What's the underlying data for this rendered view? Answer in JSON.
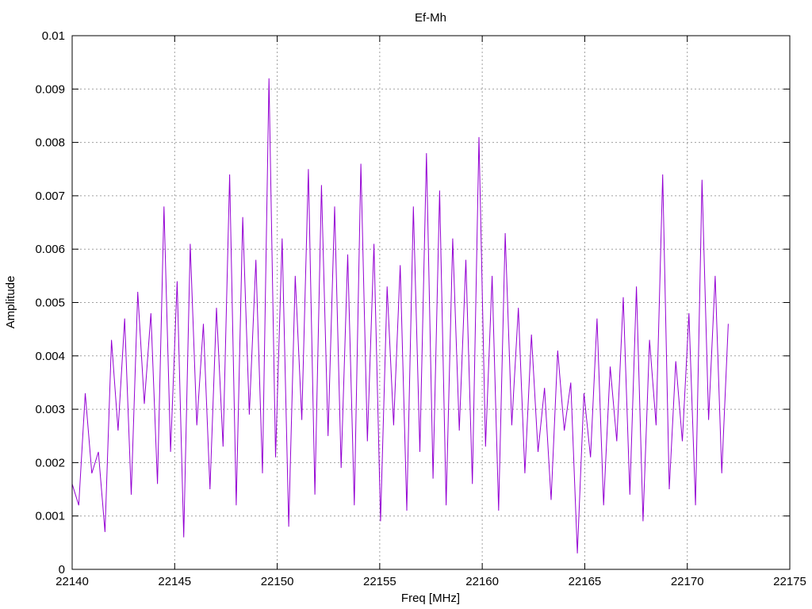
{
  "chart_data": {
    "type": "line",
    "title": "Ef-Mh",
    "xlabel": "Freq [MHz]",
    "ylabel": "Amplitude",
    "xlim": [
      22140,
      22175
    ],
    "ylim": [
      0,
      0.01
    ],
    "x_ticks": [
      "22140",
      "22145",
      "22150",
      "22155",
      "22160",
      "22165",
      "22170",
      "22175"
    ],
    "y_ticks": [
      "0",
      "0.001",
      "0.002",
      "0.003",
      "0.004",
      "0.005",
      "0.006",
      "0.007",
      "0.008",
      "0.009",
      "0.01"
    ],
    "grid": true,
    "legend": "none",
    "series": [
      {
        "color": "#9400d3",
        "x": [
          22140.0,
          22140.32,
          22140.64,
          22140.96,
          22141.28,
          22141.6,
          22141.92,
          22142.24,
          22142.56,
          22142.88,
          22143.2,
          22143.52,
          22143.84,
          22144.16,
          22144.48,
          22144.8,
          22145.12,
          22145.44,
          22145.76,
          22146.08,
          22146.4,
          22146.72,
          22147.04,
          22147.36,
          22147.68,
          22148.0,
          22148.32,
          22148.64,
          22148.96,
          22149.28,
          22149.6,
          22149.92,
          22150.24,
          22150.56,
          22150.88,
          22151.2,
          22151.52,
          22151.84,
          22152.16,
          22152.48,
          22152.8,
          22153.12,
          22153.44,
          22153.76,
          22154.08,
          22154.4,
          22154.72,
          22155.04,
          22155.36,
          22155.68,
          22156.0,
          22156.32,
          22156.64,
          22156.96,
          22157.28,
          22157.6,
          22157.92,
          22158.24,
          22158.56,
          22158.88,
          22159.2,
          22159.52,
          22159.84,
          22160.16,
          22160.48,
          22160.8,
          22161.12,
          22161.44,
          22161.76,
          22162.08,
          22162.4,
          22162.72,
          22163.04,
          22163.36,
          22163.68,
          22164.0,
          22164.32,
          22164.64,
          22164.96,
          22165.28,
          22165.6,
          22165.92,
          22166.24,
          22166.56,
          22166.88,
          22167.2,
          22167.52,
          22167.84,
          22168.16,
          22168.48,
          22168.8,
          22169.12,
          22169.44,
          22169.76,
          22170.08,
          22170.4,
          22170.72,
          22171.04,
          22171.36,
          22171.68,
          22172.0
        ],
        "y": [
          0.0016,
          0.0012,
          0.0033,
          0.0018,
          0.0022,
          0.0007,
          0.0043,
          0.0026,
          0.0047,
          0.0014,
          0.0052,
          0.0031,
          0.0048,
          0.0016,
          0.0068,
          0.0022,
          0.0054,
          0.0006,
          0.0061,
          0.0027,
          0.0046,
          0.0015,
          0.0049,
          0.0023,
          0.0074,
          0.0012,
          0.0066,
          0.0029,
          0.0058,
          0.0018,
          0.0092,
          0.0021,
          0.0062,
          0.0008,
          0.0055,
          0.0028,
          0.0075,
          0.0014,
          0.0072,
          0.0025,
          0.0068,
          0.0019,
          0.0059,
          0.0012,
          0.0076,
          0.0024,
          0.0061,
          0.0009,
          0.0053,
          0.0027,
          0.0057,
          0.0011,
          0.0068,
          0.0022,
          0.0078,
          0.0017,
          0.0071,
          0.0012,
          0.0062,
          0.0026,
          0.0058,
          0.0016,
          0.0081,
          0.0023,
          0.0055,
          0.0011,
          0.0063,
          0.0027,
          0.0049,
          0.0018,
          0.0044,
          0.0022,
          0.0034,
          0.0013,
          0.0041,
          0.0026,
          0.0035,
          0.0003,
          0.0033,
          0.0021,
          0.0047,
          0.0012,
          0.0038,
          0.0024,
          0.0051,
          0.0014,
          0.0053,
          0.0009,
          0.0043,
          0.0027,
          0.0074,
          0.0015,
          0.0039,
          0.0024,
          0.0048,
          0.0012,
          0.0073,
          0.0028,
          0.0055,
          0.0018,
          0.0046
        ]
      }
    ]
  }
}
